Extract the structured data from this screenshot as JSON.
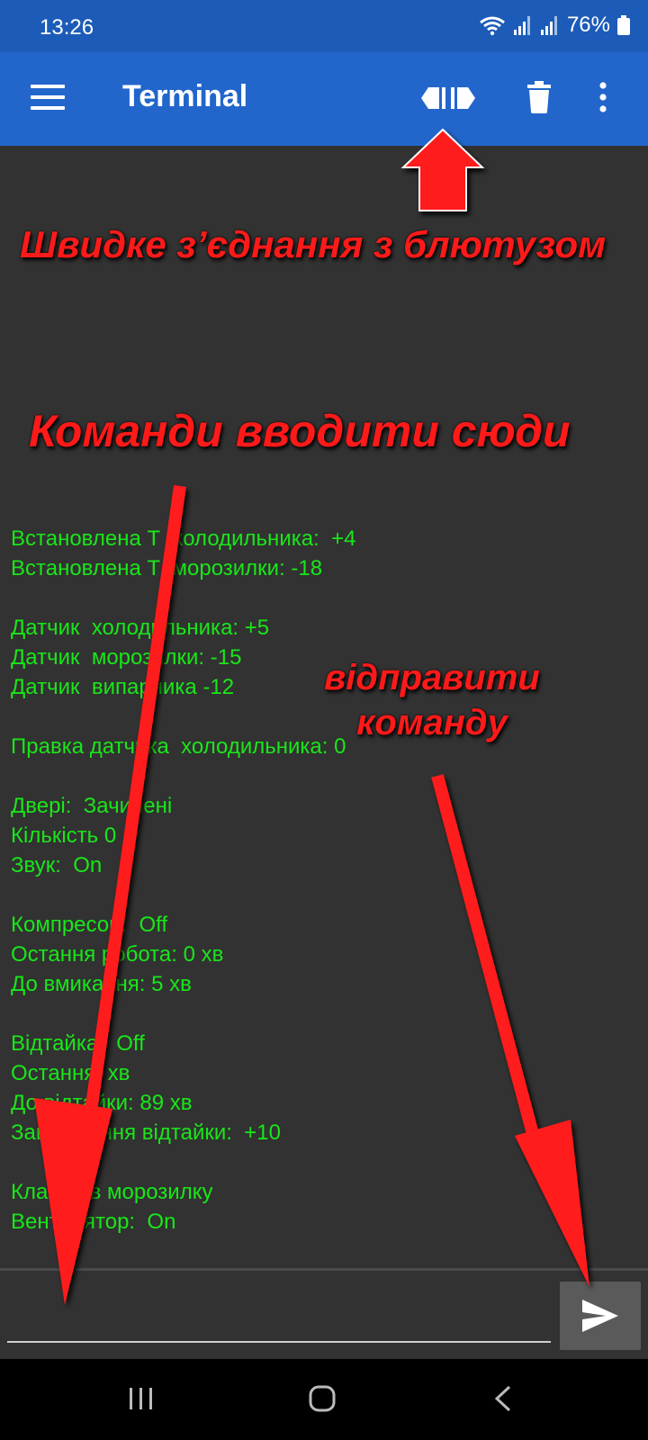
{
  "status_bar": {
    "time": "13:26",
    "battery": "76%"
  },
  "app_bar": {
    "title": "Terminal"
  },
  "terminal": {
    "lines": [
      "Встановлена Т  холодильника:  +4",
      "Встановлена Т  морозилки: -18",
      "",
      "Датчик  холодильника: +5",
      "Датчик  морозилки: -15",
      "Датчик  випарника -12",
      "",
      "Правка датчика  холодильника: 0",
      "",
      "Двері:  Зачинені",
      "Кількість 0",
      "Звук:  On",
      "",
      "Компресор:  Off",
      "Остання робота: 0 хв",
      "До вмикання: 5 хв",
      "",
      "Відтайка:  Off",
      "Остання  хв",
      "До відтайки: 89 хв",
      "Завершення відтайки:  +10",
      "",
      "Клапан в морозилку",
      "Вентилятор:  On"
    ]
  },
  "input": {
    "value": "",
    "placeholder": ""
  },
  "annotations": {
    "connect_hint": "Швидке з’єднання з блютузом",
    "input_hint": "Команди вводити сюди",
    "send_hint": "відправити команду"
  },
  "colors": {
    "app_bar": "#2266cc",
    "status_bar": "#1c5cb8",
    "terminal_bg": "#323232",
    "terminal_text": "#19e619",
    "annotation": "#ff1a1a"
  }
}
